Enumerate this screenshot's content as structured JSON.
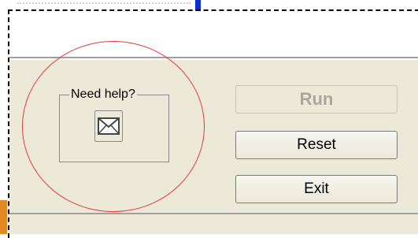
{
  "help_group": {
    "legend": "Need help?",
    "icon": "envelope-icon"
  },
  "buttons": {
    "run": "Run",
    "reset": "Reset",
    "exit": "Exit"
  },
  "colors": {
    "panel": "#ece9d8",
    "annotation": "#e53935",
    "accent_blue": "#0b2fd1",
    "accent_orange": "#e28a24",
    "disabled_text": "#a9a79b"
  }
}
